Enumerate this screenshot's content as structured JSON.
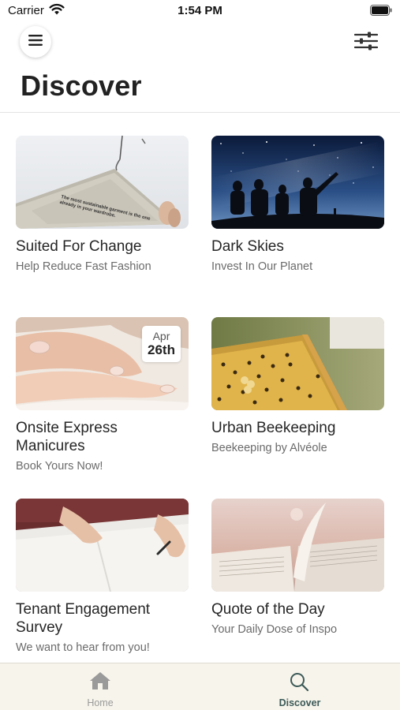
{
  "status_bar": {
    "carrier": "Carrier",
    "time": "1:54 PM",
    "icons": [
      "wifi-icon",
      "battery-icon"
    ]
  },
  "header": {
    "title": "Discover",
    "menu_icon": "hamburger-menu-icon",
    "filter_icon": "sliders-filter-icon"
  },
  "cards": [
    {
      "title": "Suited For Change",
      "subtitle": "Help Reduce Fast Fashion",
      "image": "hanger-garment-photo",
      "image_caption": "The most sustainable garment is the one already in your wardrobe."
    },
    {
      "title": "Dark Skies",
      "subtitle": "Invest In Our Planet",
      "image": "night-sky-silhouettes-photo"
    },
    {
      "title": "Onsite Express Manicures",
      "subtitle": "Book Yours Now!",
      "image": "manicure-hands-photo",
      "badge": {
        "month": "Apr",
        "day": "26th"
      }
    },
    {
      "title": "Urban Beekeeping",
      "subtitle": "Beekeeping by Alvéole",
      "image": "beehive-frame-photo"
    },
    {
      "title": "Tenant Engagement Survey",
      "subtitle": "We want to hear from you!",
      "image": "writing-notebook-photo"
    },
    {
      "title": "Quote of the Day",
      "subtitle": "Your Daily Dose of Inspo",
      "image": "open-book-sunset-photo"
    }
  ],
  "tab_bar": {
    "tabs": [
      {
        "label": "Home",
        "icon": "home-icon",
        "active": false
      },
      {
        "label": "Discover",
        "icon": "search-icon",
        "active": true
      }
    ]
  },
  "colors": {
    "active_tab": "#3c5a58",
    "inactive_tab": "#9a9a9a",
    "tab_bar_background": "#f7f4eb"
  }
}
